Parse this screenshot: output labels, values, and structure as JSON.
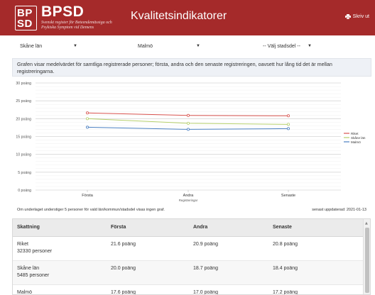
{
  "header": {
    "logo_line1": "BP",
    "logo_line2": "SD",
    "brand": "BPSD",
    "subtitle": "Svenskt register för Beteendemässiga och Psykiska Symptom vid Demens",
    "title": "Kvalitetsindikatorer",
    "print_label": "Skriv ut",
    "print_icon": "printer-icon",
    "bg_color": "#a52a2a"
  },
  "filters": {
    "region": "Skåne län",
    "municipality": "Malmö",
    "district": "-- Välj stadsdel --"
  },
  "description": "Grafen visar medelvärdet för samtliga registrerade personer; första, andra och den senaste registreringen, oavsett hur lång tid det är mellan registreringarna.",
  "chart_data": {
    "type": "line",
    "categories": [
      "Första",
      "Andra",
      "Senaste"
    ],
    "xlabel": "Registreringar",
    "ylim": [
      0,
      30
    ],
    "yticks": [
      0,
      5,
      10,
      15,
      20,
      25,
      30
    ],
    "ytick_labels": [
      "0 poäng",
      "5 poäng",
      "10 poäng",
      "15 poäng",
      "20 poäng",
      "25 poäng",
      "30 poäng"
    ],
    "grid": true,
    "legend": "right",
    "series": [
      {
        "name": "Riket",
        "values": [
          21.6,
          20.9,
          20.8
        ],
        "color": "#d9534f"
      },
      {
        "name": "Skåne län",
        "values": [
          20.0,
          18.7,
          18.4
        ],
        "color": "#b5cf6b"
      },
      {
        "name": "Malmö",
        "values": [
          17.6,
          17.0,
          17.2
        ],
        "color": "#4a7fc1"
      }
    ]
  },
  "footnote": "Om underlaget understiger 5 personer för vald län/kommun/stadsdel visas ingen graf.",
  "updated": "senast uppdaterad: 2021-01-13",
  "table": {
    "headers": [
      "Skattning",
      "Första",
      "Andra",
      "Senaste"
    ],
    "rows": [
      {
        "name": "Riket",
        "persons": "32330 personer",
        "first": "21.6 poäng",
        "second": "20.9 poäng",
        "latest": "20.8 poäng"
      },
      {
        "name": "Skåne län",
        "persons": "5485 personer",
        "first": "20.0 poäng",
        "second": "18.7 poäng",
        "latest": "18.4 poäng"
      },
      {
        "name": "Malmö",
        "persons": "",
        "first": "17.6 poäng",
        "second": "17.0 poäng",
        "latest": "17.2 poäng"
      }
    ]
  }
}
